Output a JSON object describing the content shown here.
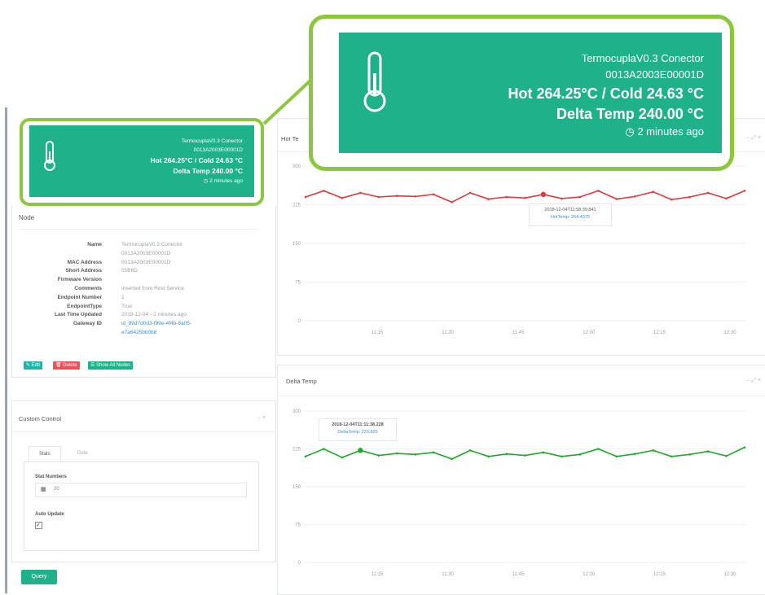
{
  "sensor_card": {
    "name": "TermocuplaV0.3 Conector",
    "mac": "0013A2003E00001D",
    "hot_cold": "Hot 264.25°C / Cold 24.63 °C",
    "delta": "Delta Temp 240.00 °C",
    "time_ago": "2 minutes ago",
    "icon": "thermometer-icon",
    "color": "#1fb189"
  },
  "node_panel": {
    "title": "Node",
    "rows": [
      {
        "label": "Name",
        "value": "TermocuplaV0.3 Conector"
      },
      {
        "label": "",
        "value": "0013A2003E00001D"
      },
      {
        "label": "MAC Address",
        "value": "0013A2003E00001D"
      },
      {
        "label": "Short Address",
        "value": "55B6D"
      },
      {
        "label": "Firmware Version",
        "value": ""
      },
      {
        "label": "Comments",
        "value": "Inserted from Rest Service"
      },
      {
        "label": "Endpoint Number",
        "value": "1"
      },
      {
        "label": "EndpointType",
        "value": "True"
      },
      {
        "label": "Last Time Updated",
        "value": "2018-12-04 - 2 minutes ago"
      },
      {
        "label": "Gateway ID",
        "value": "id_99d7d0d3-f99e-4f4b-8a05-"
      },
      {
        "label": "",
        "value": "e7a6425bb0b8"
      }
    ],
    "buttons": {
      "edit": "Edit",
      "delete": "Delete",
      "show_all": "Show All Nodes"
    }
  },
  "custom_control": {
    "title": "Custom Control",
    "tabs": [
      "Stats",
      "Data"
    ],
    "stat_numbers_label": "Stat Numbers",
    "stat_numbers_value": "20",
    "auto_update_label": "Auto Update",
    "auto_update_checked": true,
    "query_button": "Query"
  },
  "hot_chart": {
    "title": "Hot Te",
    "tooltip_time": "2018-12-04T11:58:39.841",
    "tooltip_value": "HotTemp: 264.4375",
    "color": "#e0393e"
  },
  "delta_chart": {
    "title": "Delta Temp",
    "tooltip_time": "2018-12-04T11:11:38.228",
    "tooltip_value": "DeltaTemp: 220.825",
    "color": "#1fa82a"
  },
  "chart_data": [
    {
      "type": "line",
      "title": "Hot Te",
      "ylim": [
        0,
        300
      ],
      "yticks": [
        "300",
        "225",
        "150",
        "75",
        "0"
      ],
      "xticks": [
        "11:15",
        "11:30",
        "11:45",
        "12:00",
        "12:15",
        "12:30"
      ],
      "series": [
        {
          "values": [
            240,
            252,
            238,
            248,
            240,
            242,
            241,
            245,
            230,
            248,
            236,
            240,
            238,
            245,
            237,
            240,
            252,
            236,
            241,
            250,
            235,
            240,
            248,
            237,
            252
          ]
        }
      ]
    },
    {
      "type": "line",
      "title": "Delta Temp",
      "ylim": [
        0,
        300
      ],
      "yticks": [
        "300",
        "225",
        "150",
        "75",
        "0"
      ],
      "xticks": [
        "11:15",
        "11:30",
        "11:45",
        "12:00",
        "12:15",
        "12:30"
      ],
      "series": [
        {
          "values": [
            210,
            225,
            208,
            222,
            212,
            216,
            214,
            218,
            205,
            222,
            210,
            215,
            212,
            218,
            210,
            214,
            225,
            210,
            215,
            222,
            210,
            214,
            220,
            211,
            228
          ]
        }
      ]
    }
  ]
}
